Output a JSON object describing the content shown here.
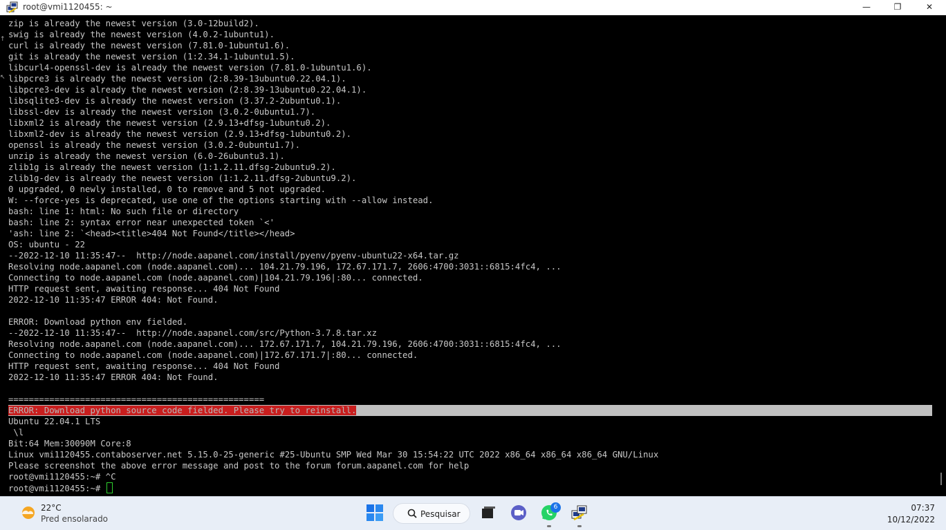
{
  "window": {
    "title": "root@vmi1120455: ~",
    "minimize": "—",
    "restore": "❐",
    "close": "✕"
  },
  "terminal": {
    "lines": [
      "zip is already the newest version (3.0-12build2).",
      "swig is already the newest version (4.0.2-1ubuntu1).",
      "curl is already the newest version (7.81.0-1ubuntu1.6).",
      "git is already the newest version (1:2.34.1-1ubuntu1.5).",
      "libcurl4-openssl-dev is already the newest version (7.81.0-1ubuntu1.6).",
      "libpcre3 is already the newest version (2:8.39-13ubuntu0.22.04.1).",
      "libpcre3-dev is already the newest version (2:8.39-13ubuntu0.22.04.1).",
      "libsqlite3-dev is already the newest version (3.37.2-2ubuntu0.1).",
      "libssl-dev is already the newest version (3.0.2-0ubuntu1.7).",
      "libxml2 is already the newest version (2.9.13+dfsg-1ubuntu0.2).",
      "libxml2-dev is already the newest version (2.9.13+dfsg-1ubuntu0.2).",
      "openssl is already the newest version (3.0.2-0ubuntu1.7).",
      "unzip is already the newest version (6.0-26ubuntu3.1).",
      "zlib1g is already the newest version (1:1.2.11.dfsg-2ubuntu9.2).",
      "zlib1g-dev is already the newest version (1:1.2.11.dfsg-2ubuntu9.2).",
      "0 upgraded, 0 newly installed, 0 to remove and 5 not upgraded.",
      "W: --force-yes is deprecated, use one of the options starting with --allow instead.",
      "bash: line 1: html: No such file or directory",
      "bash: line 2: syntax error near unexpected token `<'",
      "'ash: line 2: `<head><title>404 Not Found</title></head>",
      "OS: ubuntu - 22",
      "--2022-12-10 11:35:47--  http://node.aapanel.com/install/pyenv/pyenv-ubuntu22-x64.tar.gz",
      "Resolving node.aapanel.com (node.aapanel.com)... 104.21.79.196, 172.67.171.7, 2606:4700:3031::6815:4fc4, ...",
      "Connecting to node.aapanel.com (node.aapanel.com)|104.21.79.196|:80... connected.",
      "HTTP request sent, awaiting response... 404 Not Found",
      "2022-12-10 11:35:47 ERROR 404: Not Found.",
      "",
      "ERROR: Download python env fielded.",
      "--2022-12-10 11:35:47--  http://node.aapanel.com/src/Python-3.7.8.tar.xz",
      "Resolving node.aapanel.com (node.aapanel.com)... 172.67.171.7, 104.21.79.196, 2606:4700:3031::6815:4fc4, ...",
      "Connecting to node.aapanel.com (node.aapanel.com)|172.67.171.7|:80... connected.",
      "HTTP request sent, awaiting response... 404 Not Found",
      "2022-12-10 11:35:47 ERROR 404: Not Found.",
      "",
      "=================================================="
    ],
    "error_line": "ERROR: Download python source code fielded. Please try to reinstall.",
    "after_lines": [
      "Ubuntu 22.04.1 LTS",
      " \\l",
      "Bit:64 Mem:30090M Core:8",
      "Linux vmi1120455.contaboserver.net 5.15.0-25-generic #25-Ubuntu SMP Wed Mar 30 15:54:22 UTC 2022 x86_64 x86_64 x86_64 GNU/Linux",
      "Please screenshot the above error message and post to the forum forum.aapanel.com for help",
      "root@vmi1120455:~# ^C"
    ],
    "prompt": "root@vmi1120455:~# "
  },
  "taskbar": {
    "weather_temp": "22°C",
    "weather_cond": "Pred ensolarado",
    "search_label": "Pesquisar",
    "whatsapp_badge": "6",
    "time": "07:37",
    "date": "10/12/2022"
  }
}
